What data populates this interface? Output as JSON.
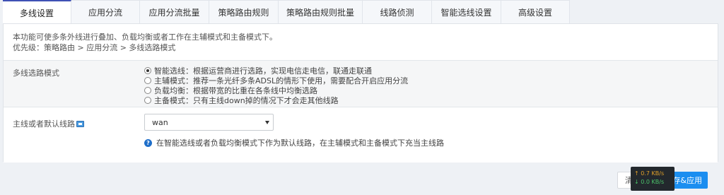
{
  "tabs": [
    {
      "label": "多线设置"
    },
    {
      "label": "应用分流"
    },
    {
      "label": "应用分流批量"
    },
    {
      "label": "策略路由规则"
    },
    {
      "label": "策略路由规则批量"
    },
    {
      "label": "线路侦测"
    },
    {
      "label": "智能选线设置"
    },
    {
      "label": "高级设置"
    }
  ],
  "active_tab": "多线设置",
  "description": {
    "line1": "本功能可使多条外线进行叠加、负载均衡或者工作在主辅模式和主备模式下。",
    "line2": "优先级：策略路由 > 应用分流 > 多线选路模式"
  },
  "mode": {
    "label": "多线选路模式",
    "selected_index": 0,
    "options": [
      {
        "text": "智能选线：根据运营商进行选路，实现电信走电信，联通走联通"
      },
      {
        "text": "主辅模式：推荐一条光纤多条ADSL的情形下使用，需要配合开启应用分流"
      },
      {
        "text": "负载均衡：根据带宽的比重在各条线中均衡选路"
      },
      {
        "text": "主备模式：只有主线down掉的情况下才会走其他线路"
      }
    ]
  },
  "default_line": {
    "label": "主线或者默认线路",
    "value": "wan",
    "hint": "在智能选线或者负载均衡模式下作为默认线路，在主辅模式和主备模式下充当主线路"
  },
  "buttons": {
    "cancel": "清",
    "apply": "存&应用"
  },
  "speed": {
    "up": "↑ 0.7 KB/s",
    "down": "↓ 0.0 KB/s"
  },
  "colors": {
    "accent_tab": "#3f51b5",
    "apply_button": "#1b8ef0"
  }
}
